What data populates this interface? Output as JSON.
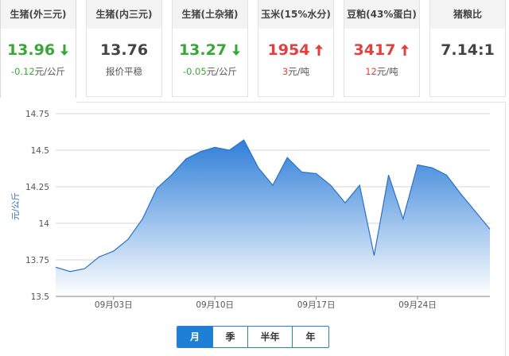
{
  "cards": [
    {
      "title": "生猪(外三元)",
      "price": "13.96",
      "trend": "down",
      "change_value": "-0.12",
      "change_unit": "元/公斤"
    },
    {
      "title": "生猪(内三元)",
      "price": "13.76",
      "trend": "flat",
      "change_value": "",
      "change_unit": "报价平稳"
    },
    {
      "title": "生猪(土杂猪)",
      "price": "13.27",
      "trend": "down",
      "change_value": "-0.05",
      "change_unit": "元/公斤"
    },
    {
      "title": "玉米(15%水分)",
      "price": "1954",
      "trend": "up",
      "change_value": "3",
      "change_unit": "元/吨"
    },
    {
      "title": "豆粕(43%蛋白)",
      "price": "3417",
      "trend": "up",
      "change_value": "12",
      "change_unit": "元/吨"
    },
    {
      "title": "猪粮比",
      "price": "7.14:1",
      "trend": "flat",
      "change_value": "",
      "change_unit": ""
    }
  ],
  "colors": {
    "down": "#3aa63a",
    "up": "#e2403e",
    "accent": "#1e7fd6",
    "area_top": "#2f7fd8",
    "area_bottom": "#ffffff"
  },
  "tabs": [
    {
      "label": "月",
      "selected": true
    },
    {
      "label": "季",
      "selected": false
    },
    {
      "label": "半年",
      "selected": false
    },
    {
      "label": "年",
      "selected": false
    }
  ],
  "chart_data": {
    "type": "area",
    "ylabel": "元/公斤",
    "ylim": [
      13.5,
      14.75
    ],
    "yticks": [
      "14.75",
      "14.5",
      "14.25",
      "14",
      "13.75",
      "13.5"
    ],
    "x_tick_labels": [
      {
        "label": "09月03日",
        "day": 3
      },
      {
        "label": "09月10日",
        "day": 10
      },
      {
        "label": "09月17日",
        "day": 17
      },
      {
        "label": "09月24日",
        "day": 24
      }
    ],
    "xlim": [
      -1,
      28
    ],
    "grid": true,
    "series": [
      {
        "points": [
          [
            -1.0,
            13.7
          ],
          [
            0.0,
            13.67
          ],
          [
            1.0,
            13.69
          ],
          [
            2.0,
            13.77
          ],
          [
            3.0,
            13.81
          ],
          [
            4.0,
            13.89
          ],
          [
            5.0,
            14.03
          ],
          [
            6.0,
            14.24
          ],
          [
            7.0,
            14.33
          ],
          [
            8.0,
            14.44
          ],
          [
            9.0,
            14.49
          ],
          [
            10.0,
            14.52
          ],
          [
            11.0,
            14.5
          ],
          [
            12.0,
            14.57
          ],
          [
            13.0,
            14.38
          ],
          [
            14.0,
            14.26
          ],
          [
            15.0,
            14.45
          ],
          [
            16.0,
            14.35
          ],
          [
            17.0,
            14.34
          ],
          [
            18.0,
            14.26
          ],
          [
            19.0,
            14.14
          ],
          [
            20.0,
            14.26
          ],
          [
            21.0,
            13.78
          ],
          [
            22.0,
            14.33
          ],
          [
            23.0,
            14.03
          ],
          [
            24.0,
            14.4
          ],
          [
            25.0,
            14.38
          ],
          [
            26.0,
            14.33
          ],
          [
            27.0,
            14.2
          ],
          [
            28.0,
            14.08
          ],
          [
            29.0,
            13.96
          ]
        ]
      }
    ]
  }
}
